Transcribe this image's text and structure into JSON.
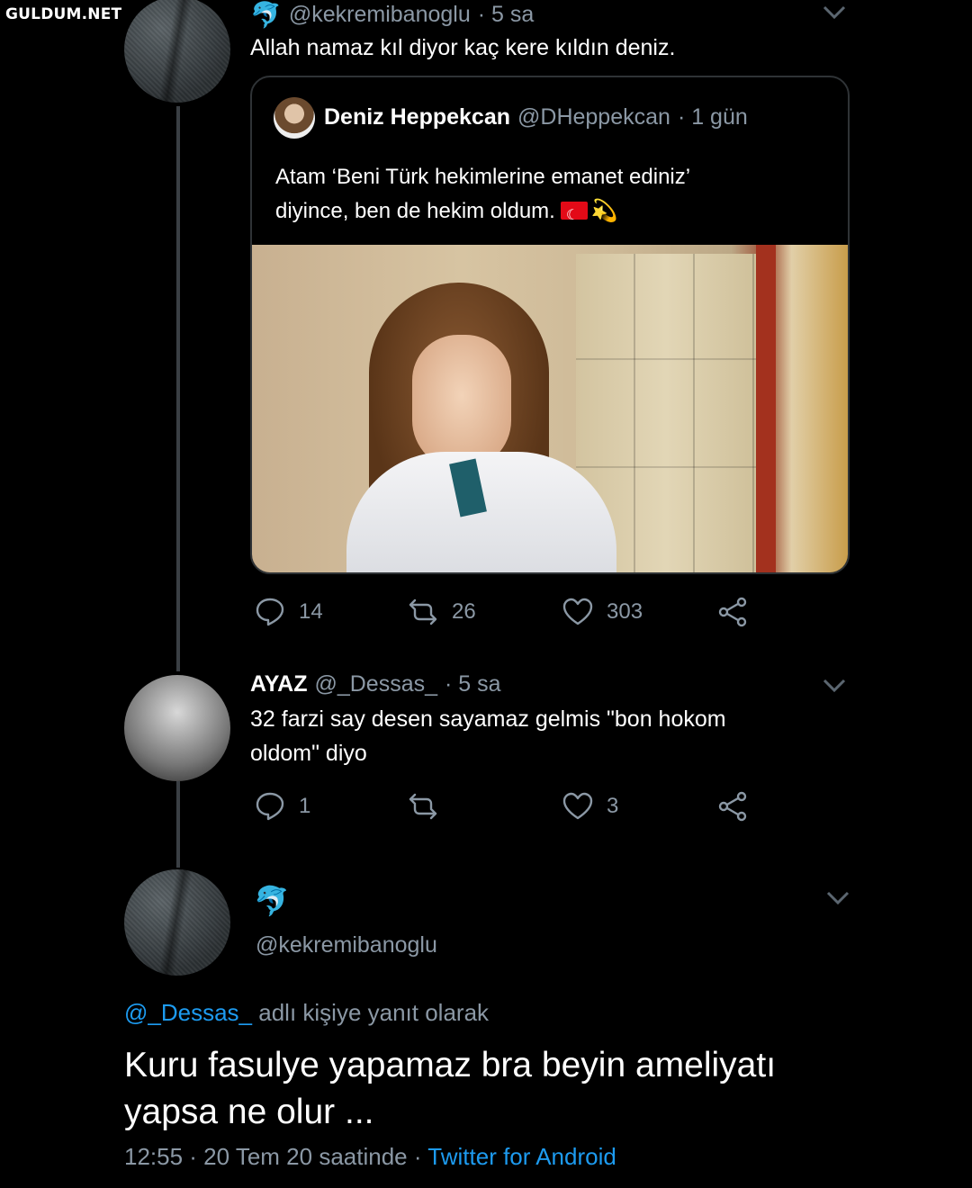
{
  "watermark": "GULDUM.NET",
  "tweet1": {
    "emoji": "🐬",
    "handle": "@kekremibanoglu",
    "time": "· 5 sa",
    "text": "Allah namaz kıl diyor kaç kere kıldın deniz."
  },
  "quote": {
    "name": "Deniz Heppekcan",
    "handle": "@DHeppekcan",
    "time": "· 1 gün",
    "text_line1": "Atam ‘Beni Türk hekimlerine emanet ediniz’",
    "text_line2": "diyince, ben de hekim oldum.",
    "emoji_dizzy": "💫"
  },
  "tweet1_actions": {
    "replies": "14",
    "retweets": "26",
    "likes": "303"
  },
  "tweet2": {
    "name": "AYAZ",
    "handle": "@_Dessas_",
    "time": "· 5 sa",
    "text_line1": "32 farzi say desen sayamaz gelmis \"bon hokom",
    "text_line2": "oldom\" diyo"
  },
  "tweet2_actions": {
    "replies": "1",
    "retweets": "",
    "likes": "3"
  },
  "main_tweet": {
    "emoji": "🐬",
    "handle": "@kekremibanoglu",
    "replying_mention": "@_Dessas_",
    "replying_suffix": "adlı kişiye yanıt olarak",
    "text_line1": "Kuru fasulye yapamaz bra beyin ameliyatı",
    "text_line2": "yapsa ne olur ...",
    "timestamp": "12:55 · 20 Tem 20 saatinde ·",
    "source": "Twitter for Android"
  },
  "colors": {
    "background": "#000000",
    "secondary_text": "#8b98a5",
    "link": "#1d9bf0"
  }
}
